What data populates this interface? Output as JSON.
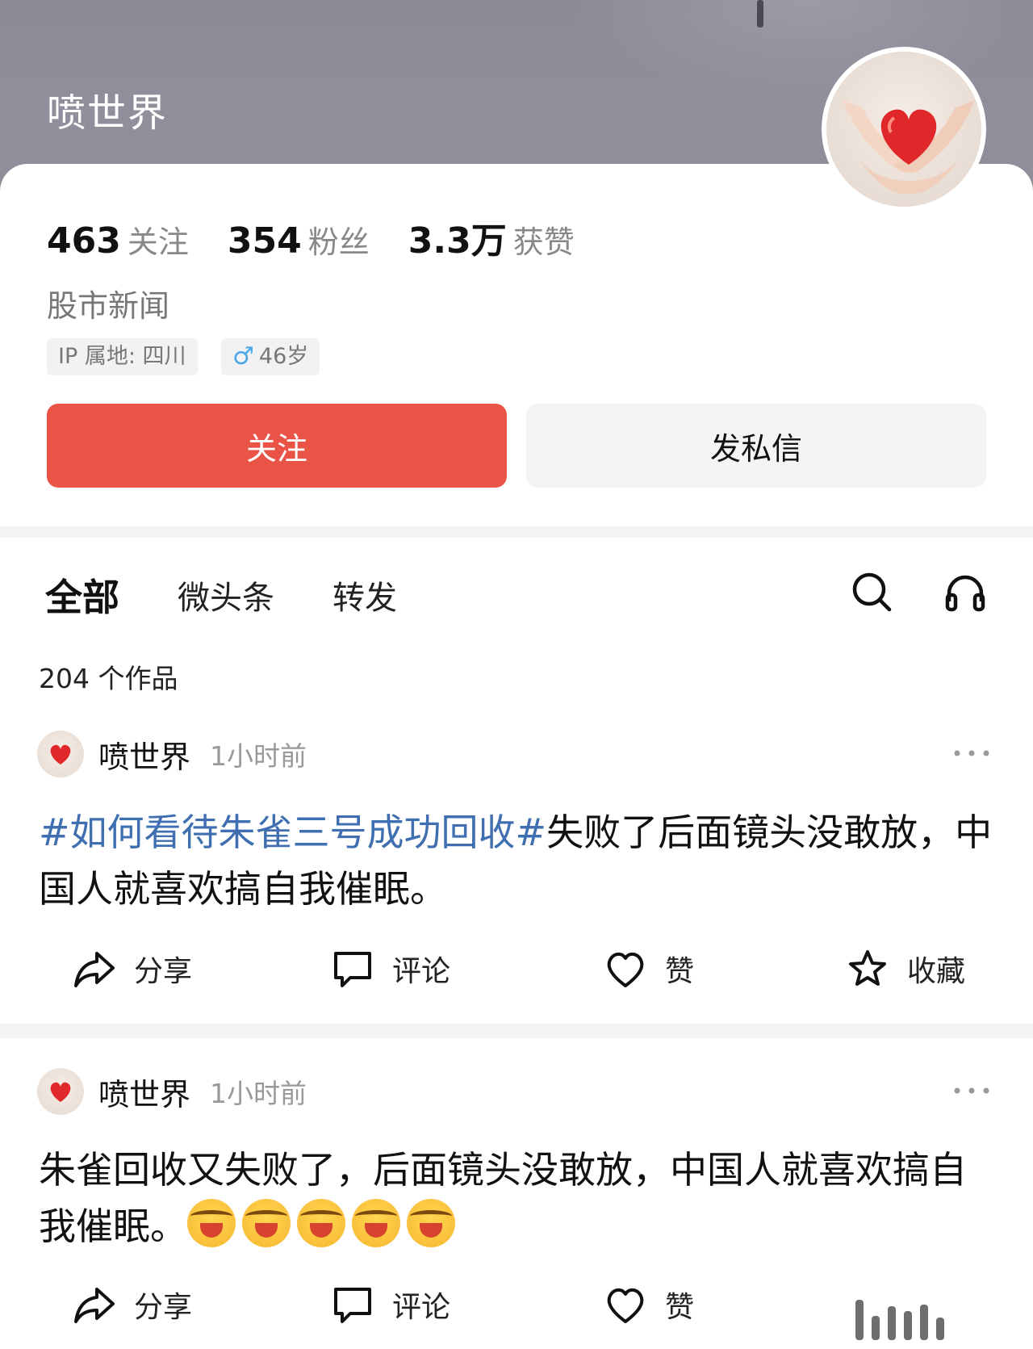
{
  "profile": {
    "name": "喷世界",
    "stats": [
      {
        "value": "463",
        "label": "关注"
      },
      {
        "value": "354",
        "label": "粉丝"
      },
      {
        "value": "3.3万",
        "label": "获赞"
      }
    ],
    "bio": "股市新闻",
    "ip_tag": "IP 属地: 四川",
    "age_tag": "46岁",
    "gender_icon": "male-icon"
  },
  "buttons": {
    "follow": "关注",
    "message": "发私信"
  },
  "tabs": {
    "items": [
      "全部",
      "微头条",
      "转发"
    ],
    "active": "全部"
  },
  "works_count": "204 个作品",
  "posts": [
    {
      "author": "喷世界",
      "time": "1小时前",
      "hashtag": "#如何看待朱雀三号成功回收#",
      "text": "失败了后面镜头没敢放，中国人就喜欢搞自我催眠。",
      "actions": {
        "share": "分享",
        "comment": "评论",
        "like": "赞",
        "favorite": "收藏"
      }
    },
    {
      "author": "喷世界",
      "time": "1小时前",
      "text": "朱雀回收又失败了，后面镜头没敢放，中国人就喜欢搞自我催眠。",
      "emoji_count": 5,
      "emoji": "😭",
      "actions": {
        "share": "分享",
        "comment": "评论",
        "like": "赞"
      }
    }
  ],
  "colors": {
    "accent": "#ea5446",
    "hashtag": "#3f6fb0",
    "header_bg": "#8f8d99"
  }
}
